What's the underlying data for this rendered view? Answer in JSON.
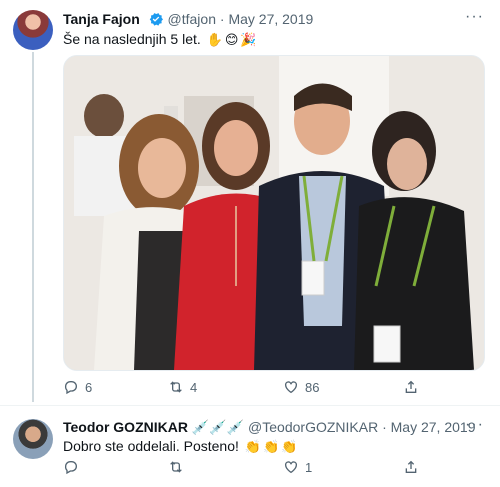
{
  "tweet1": {
    "author_name": "Tanja Fajon",
    "handle": "@tfajon",
    "separator": "·",
    "date": "May 27, 2019",
    "more": "···",
    "text": "Še na naslednjih 5 let.",
    "emojis": [
      "✋",
      "😊",
      "🎉"
    ],
    "replies": "6",
    "retweets": "4",
    "likes": "86"
  },
  "tweet2": {
    "author_name": "Teodor GOZNIKAR",
    "name_suffix": "💉💉💉",
    "handle": "@TeodorGOZNIKAR",
    "separator": "·",
    "date": "May 27, 2019",
    "more": "···",
    "text": "Dobro ste oddelali. Posteno!",
    "emojis": [
      "👏",
      "👏",
      "👏"
    ],
    "replies": "",
    "retweets": "",
    "likes": "1"
  },
  "colors": {
    "verified": "#1d9bf0",
    "muted": "#536471",
    "text": "#0f1419"
  },
  "icons": [
    "verified-badge-icon",
    "more-icon",
    "reply-icon",
    "retweet-icon",
    "like-icon",
    "share-icon"
  ]
}
